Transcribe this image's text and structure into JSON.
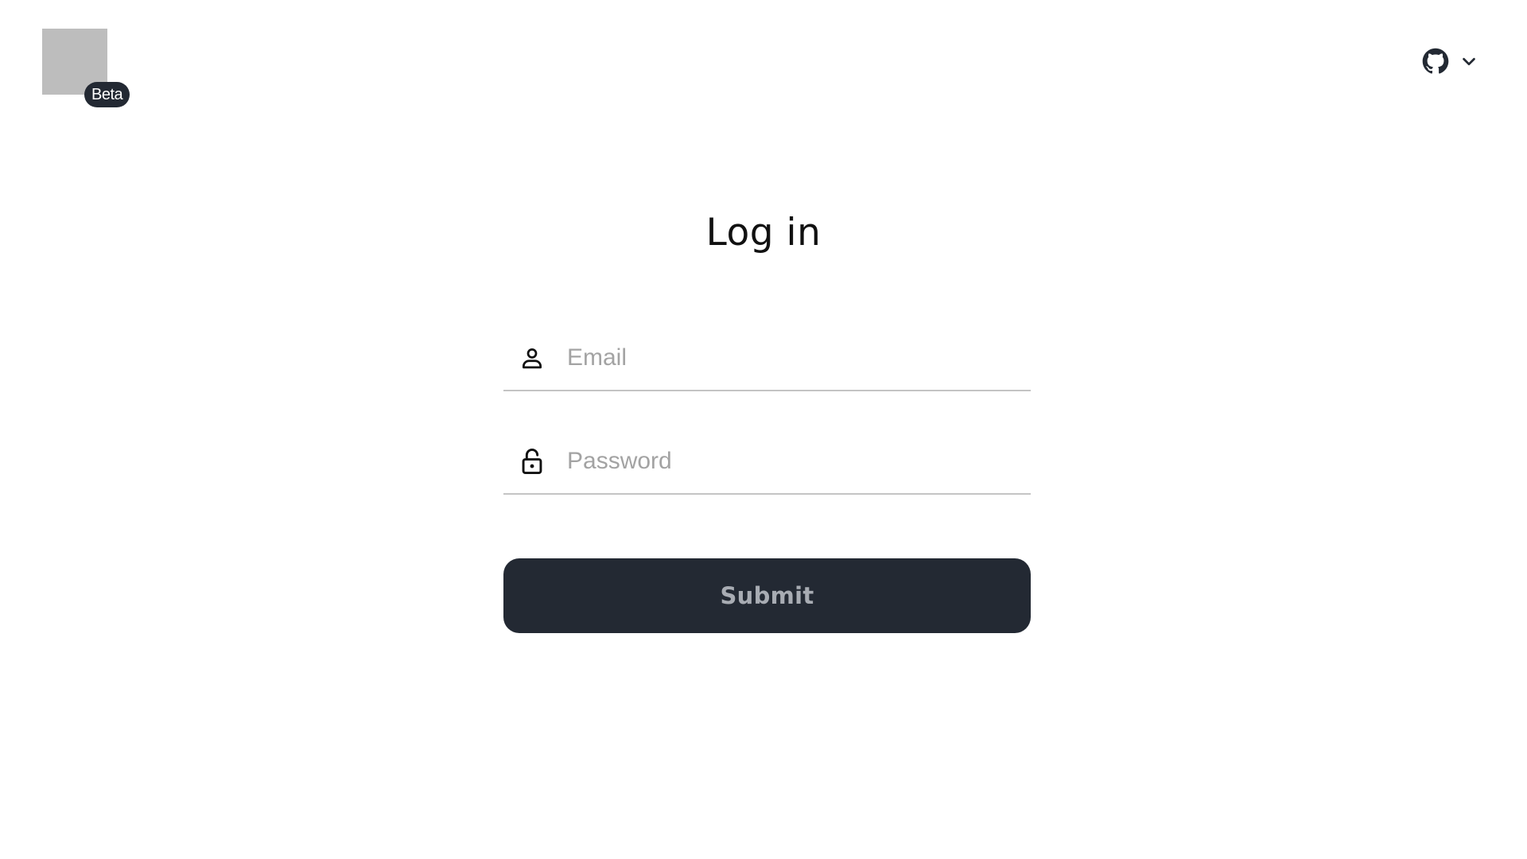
{
  "header": {
    "badge": "Beta",
    "account_menu": {
      "icons": [
        "github-icon",
        "chevron-down-icon"
      ]
    }
  },
  "login": {
    "title": "Log in",
    "email": {
      "placeholder": "Email",
      "value": "",
      "icon": "user-icon"
    },
    "password": {
      "placeholder": "Password",
      "value": "",
      "icon": "lock-icon"
    },
    "submit_label": "Submit"
  },
  "colors": {
    "dark": "#232933",
    "logo_placeholder": "#bdbdbd",
    "placeholder_text": "#a3a3a3",
    "submit_text": "#a8acb3",
    "underline": "#c4c4c4"
  }
}
